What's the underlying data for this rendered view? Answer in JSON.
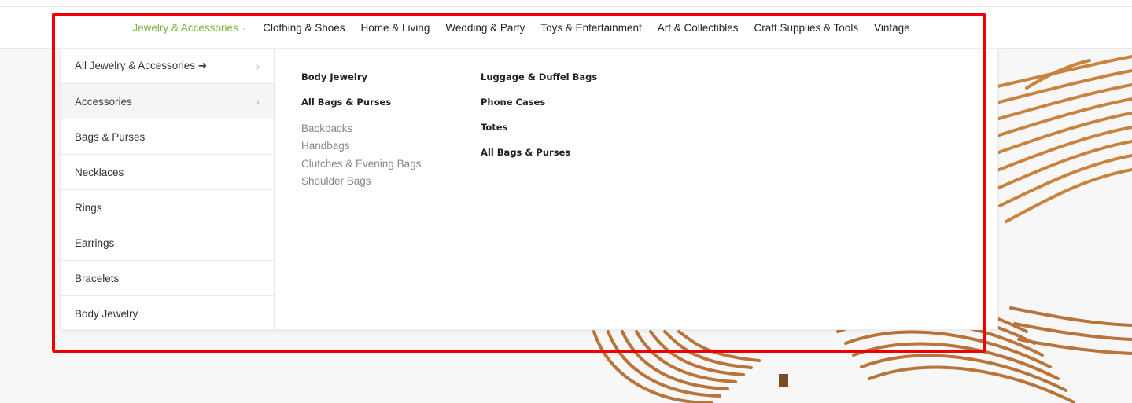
{
  "nav": {
    "items": [
      {
        "label": "Jewelry & Accessories",
        "active": true
      },
      {
        "label": "Clothing & Shoes"
      },
      {
        "label": "Home & Living"
      },
      {
        "label": "Wedding & Party"
      },
      {
        "label": "Toys & Entertainment"
      },
      {
        "label": "Art & Collectibles"
      },
      {
        "label": "Craft Supplies & Tools"
      },
      {
        "label": "Vintage"
      }
    ],
    "caret": "⌄",
    "active_color": "#7cb342"
  },
  "mega_menu": {
    "left": [
      {
        "label": "All Jewelry & Accessories ➜",
        "has_arrow": true
      },
      {
        "label": "Accessories",
        "has_arrow": true,
        "highlighted": true
      },
      {
        "label": "Bags & Purses"
      },
      {
        "label": "Necklaces"
      },
      {
        "label": "Rings"
      },
      {
        "label": "Earrings"
      },
      {
        "label": "Bracelets"
      },
      {
        "label": "Body Jewelry"
      }
    ],
    "chevron": "›",
    "col1_headings": [
      "Body Jewelry",
      "All Bags & Purses"
    ],
    "col1_links": [
      "Backpacks",
      "Handbags",
      "Clutches & Evening Bags",
      "Shoulder Bags"
    ],
    "col2_headings": [
      "Luggage & Duffel Bags",
      "Phone Cases",
      "Totes",
      "All Bags & Purses"
    ]
  },
  "annotation": {
    "color": "#f10000"
  }
}
